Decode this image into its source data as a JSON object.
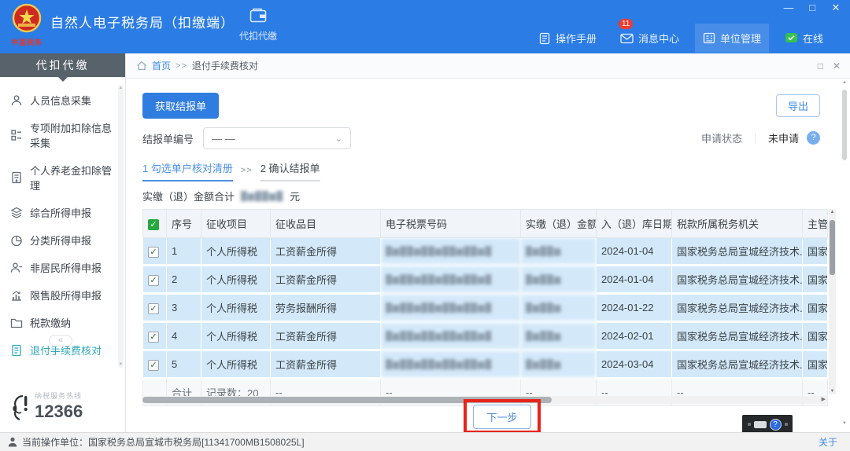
{
  "window": {
    "minimize": "—",
    "maximize": "□",
    "close": "✕"
  },
  "icons": {
    "check": "✓",
    "chevron": "⌄",
    "collapse": "«",
    "help": "?",
    "scroll_up": "▲",
    "scroll_down": "▼",
    "scroll_right": "▶"
  },
  "app_header": {
    "logo_text": "中国税务",
    "title": "自然人电子税务局（扣缴端）",
    "nav_tab_label": "代扣代缴",
    "links": [
      {
        "label": "操作手册"
      },
      {
        "label": "消息中心",
        "badge": "11"
      },
      {
        "label": "单位管理"
      },
      {
        "label": "在线"
      }
    ]
  },
  "sidebar": {
    "header": "代扣代缴",
    "items": [
      {
        "label": "人员信息采集"
      },
      {
        "label": "专项附加扣除信息采集"
      },
      {
        "label": "个人养老金扣除管理"
      },
      {
        "label": "综合所得申报"
      },
      {
        "label": "分类所得申报"
      },
      {
        "label": "非居民所得申报"
      },
      {
        "label": "限售股所得申报"
      },
      {
        "label": "税款缴纳"
      },
      {
        "label": "退付手续费核对"
      }
    ],
    "hotline": {
      "label": "纳税服务热线",
      "number": "12366"
    }
  },
  "breadcrumb": {
    "home": "首页",
    "separator": ">>",
    "current": "退付手续费核对"
  },
  "toolbar": {
    "fetch_button": "获取结报单",
    "export_button": "导出",
    "form_number_label": "结报单编号",
    "form_number_value": "— —",
    "apply_status_label": "申请状态",
    "status_separator": "｜",
    "apply_status_value": "未申请"
  },
  "steps": [
    {
      "label": "1 勾选单户核对清册"
    },
    {
      "label": "2 确认结报单"
    }
  ],
  "steps_separator": ">>",
  "summary": {
    "label": "实缴（退）金额合计",
    "amount_masked": "█▆██▆█",
    "unit": "元"
  },
  "table": {
    "headers": [
      "序号",
      "征收项目",
      "征收品目",
      "电子税票号码",
      "实缴（退）金额",
      "入（退）库日期",
      "税款所属税务机关",
      "主管"
    ],
    "rows": [
      {
        "seq": "1",
        "project": "个人所得税",
        "item": "工资薪金所得",
        "receipt": "█▆██▆██▆██▆██▆█",
        "amount": "█▆██▆",
        "date": "2024-01-04",
        "agency": "国家税务总局宣城经济技术...",
        "manager": "国家"
      },
      {
        "seq": "2",
        "project": "个人所得税",
        "item": "工资薪金所得",
        "receipt": "█▆██▆██▆██▆██▆█",
        "amount": "█▆██▆",
        "date": "2024-01-04",
        "agency": "国家税务总局宣城经济技术...",
        "manager": "国家"
      },
      {
        "seq": "3",
        "project": "个人所得税",
        "item": "劳务报酬所得",
        "receipt": "█▆██▆██▆██▆██▆█",
        "amount": "█▆██▆",
        "date": "2024-01-22",
        "agency": "国家税务总局宣城经济技术...",
        "manager": "国家"
      },
      {
        "seq": "4",
        "project": "个人所得税",
        "item": "工资薪金所得",
        "receipt": "█▆██▆██▆██▆██▆█",
        "amount": "█▆██▆",
        "date": "2024-02-01",
        "agency": "国家税务总局宣城经济技术...",
        "manager": "国家"
      },
      {
        "seq": "5",
        "project": "个人所得税",
        "item": "工资薪金所得",
        "receipt": "█▆██▆██▆██▆██▆█",
        "amount": "█▆██▆",
        "date": "2024-03-04",
        "agency": "国家税务总局宣城经济技术...",
        "manager": "国家"
      }
    ],
    "footer": {
      "label": "合计",
      "count": "记录数：20",
      "dash": "--"
    }
  },
  "actions": {
    "next_button": "下一步"
  },
  "status_bar": {
    "text": "当前操作单位：国家税务总局宣城市税务局[11341700MB1508025L]",
    "about": "关于"
  }
}
